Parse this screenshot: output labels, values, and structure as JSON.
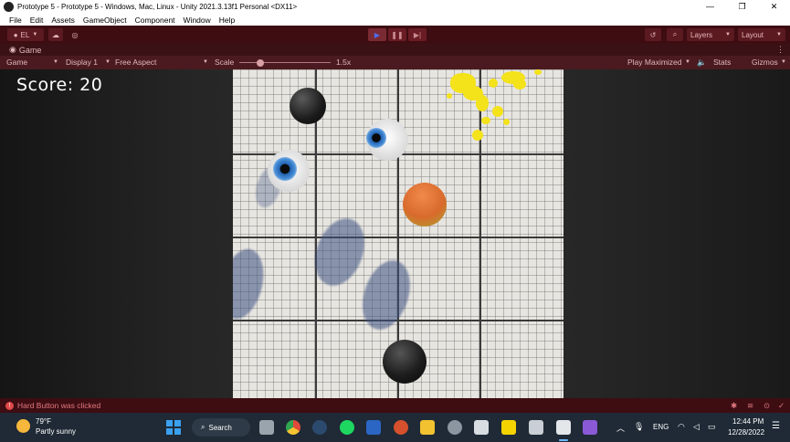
{
  "window": {
    "title": "Prototype 5 - Prototype 5 - Windows, Mac, Linux - Unity 2021.3.13f1 Personal <DX11>",
    "controls": [
      "—",
      "❐",
      "✕"
    ]
  },
  "menu": [
    "File",
    "Edit",
    "Assets",
    "GameObject",
    "Component",
    "Window",
    "Help"
  ],
  "toolbar": {
    "account": "EL",
    "layers": "Layers",
    "layout": "Layout"
  },
  "tab": {
    "label": "Game"
  },
  "gamebar": {
    "mode": "Game",
    "display": "Display 1",
    "aspect": "Free Aspect",
    "scale_label": "Scale",
    "scale_value": "1.5x",
    "play_mode": "Play Maximized",
    "stats": "Stats",
    "gizmos": "Gizmos"
  },
  "game": {
    "score": "Score: 20"
  },
  "status": {
    "message": "Hard Button was clicked"
  },
  "taskbar": {
    "weather_temp": "79°F",
    "weather_desc": "Partly sunny",
    "search": "Search",
    "lang": "ENG",
    "time": "12:44 PM",
    "date": "12/28/2022"
  },
  "colors": {
    "toolbar_bg": "#3d0d12",
    "taskbar_bg": "#1f2a36",
    "play_accent": "#4e6ef0"
  }
}
